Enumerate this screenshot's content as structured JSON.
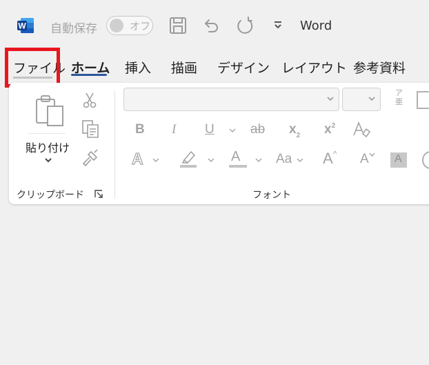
{
  "app": {
    "name": "Word",
    "logo_letter": "W",
    "autosave_label": "自動保存",
    "autosave_state": "オフ"
  },
  "tabs": [
    {
      "label": "ファイル",
      "active": false,
      "highlighted": true
    },
    {
      "label": "ホーム",
      "active": true
    },
    {
      "label": "挿入"
    },
    {
      "label": "描画"
    },
    {
      "label": "デザイン"
    },
    {
      "label": "レイアウト"
    },
    {
      "label": "参考資料"
    }
  ],
  "ribbon": {
    "clipboard": {
      "group_label": "クリップボード",
      "paste_label": "貼り付け"
    },
    "font": {
      "group_label": "フォント",
      "font_name": "",
      "font_size": "",
      "bold": "B",
      "italic": "I",
      "underline": "U",
      "strikethrough": "ab",
      "subscript": "x",
      "subscript_mark": "2",
      "superscript": "x",
      "superscript_mark": "2",
      "change_case": "Aa",
      "text_effect": "A",
      "font_color": "A",
      "grow_font": "A",
      "shrink_font": "A",
      "char_shading": "A",
      "phonetic_top": "ア",
      "phonetic_bottom": "亜"
    }
  },
  "colors": {
    "word_blue": "#185abd",
    "highlight_red": "#e8161f",
    "active_tab_underline": "#2b579a",
    "disabled_gray": "#a4a4a4"
  }
}
